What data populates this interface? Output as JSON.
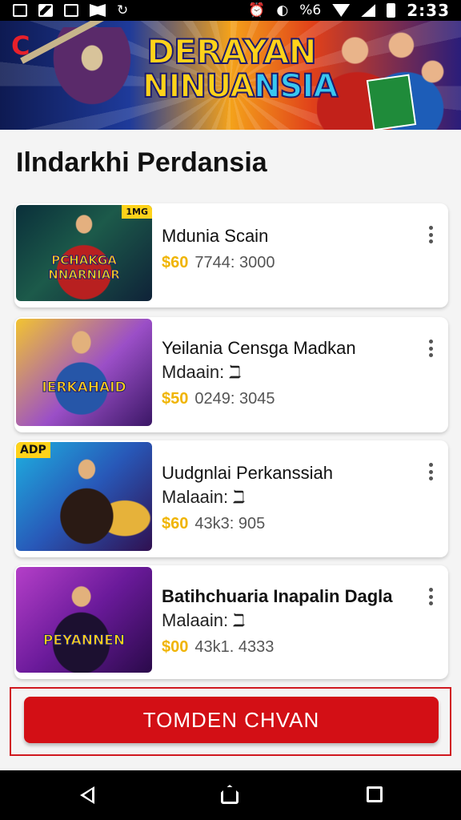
{
  "status_bar": {
    "battery_label": "%6",
    "time": "2:33"
  },
  "banner": {
    "logo": "C",
    "title_line1": "DERAYAN",
    "title_line2_a": "NINUA",
    "title_line2_b": "NSIA"
  },
  "page_title": "Ilndarkhi Perdansia",
  "items": [
    {
      "thumb_label": "PCHAKGA NNARNIAR",
      "badge": "1MG",
      "name": "Mdunia Scain",
      "sub": "",
      "price": "$60",
      "meta": "7744: 3000"
    },
    {
      "thumb_label": "IERKAHAID",
      "badge": "",
      "name": "Yeilania Censga Madkan",
      "sub": "Mdaain: ℶ",
      "price": "$50",
      "meta": "0249: 3045"
    },
    {
      "thumb_label": "",
      "badge": "ADP",
      "name": "Uudgnlai Perkanssiah",
      "sub": "Malaain: ℶ",
      "price": "$60",
      "meta": "43k3: 905"
    },
    {
      "thumb_label": "PEYANNEN",
      "badge": "",
      "name": "Batihchuaria Inapalin Dagla",
      "sub": "Malaain: ℶ",
      "price": "$00",
      "meta": "43k1. 4333"
    }
  ],
  "cta": {
    "label": "TOMDEN CHVAN"
  },
  "colors": {
    "accent_red": "#d30f15",
    "price_yellow": "#f0b400"
  },
  "icons": {
    "nav": [
      "back-icon",
      "home-icon",
      "recent-apps-icon"
    ]
  }
}
